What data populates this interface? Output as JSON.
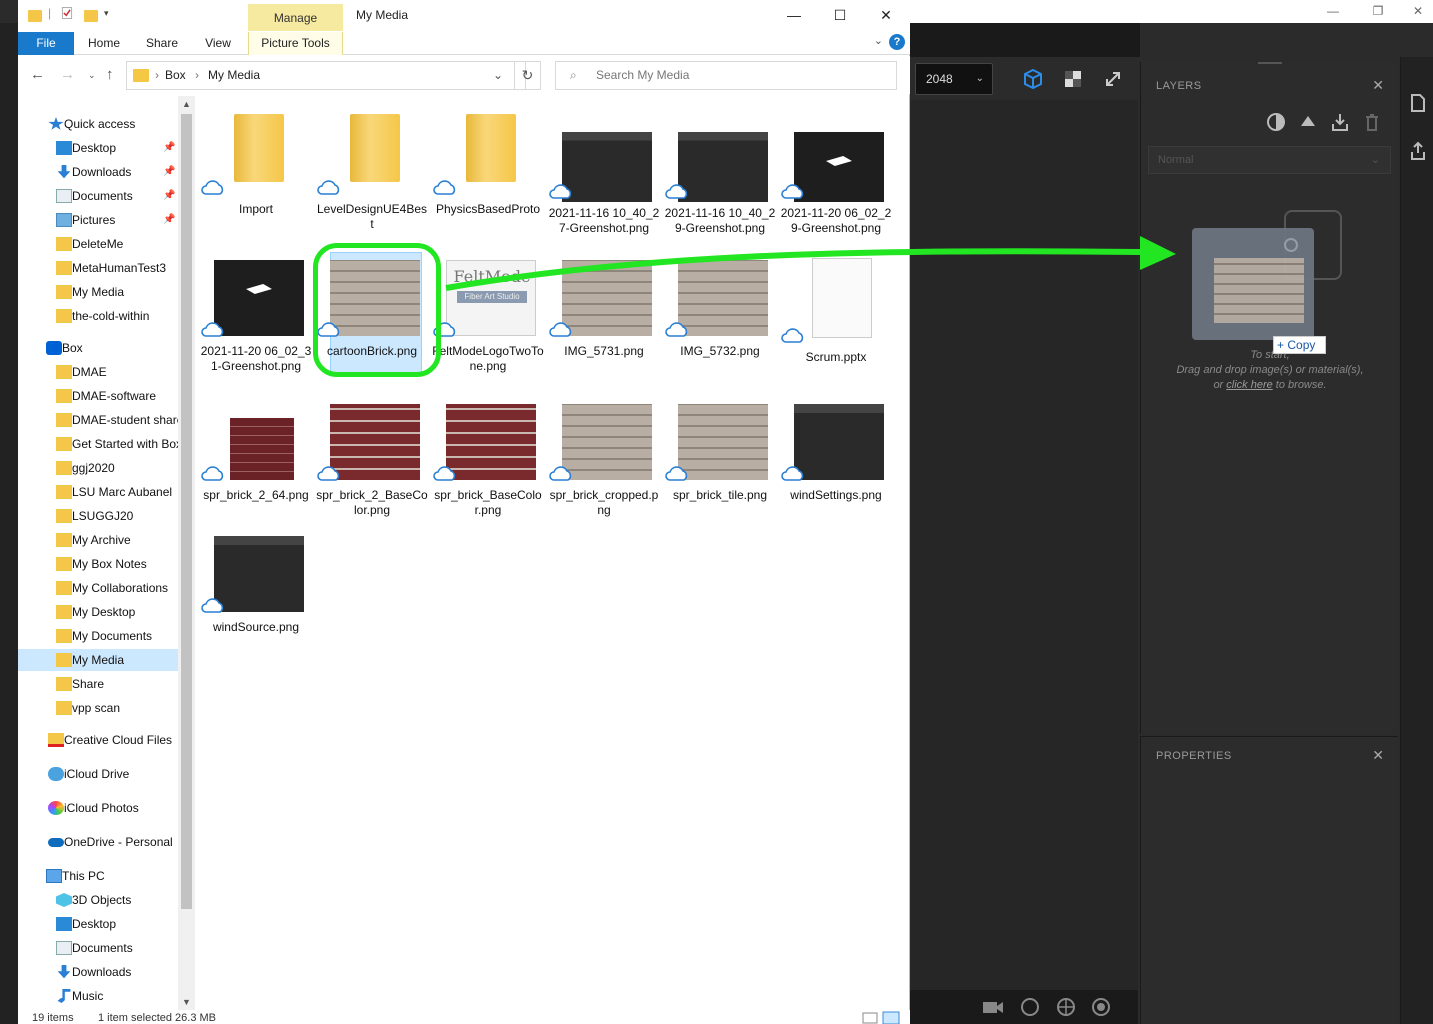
{
  "explorer": {
    "window_title": "My Media",
    "ribbon_context": "Manage",
    "tabs": [
      "File",
      "Home",
      "Share",
      "View",
      "Picture Tools"
    ],
    "address": {
      "segments": [
        "Box",
        "My Media"
      ]
    },
    "search_placeholder": "Search My Media",
    "nav": {
      "quick_access": {
        "label": "Quick access",
        "items": [
          "Desktop",
          "Downloads",
          "Documents",
          "Pictures",
          "DeleteMe",
          "MetaHumanTest3",
          "My Media",
          "the-cold-within"
        ]
      },
      "box": {
        "label": "Box",
        "items": [
          "DMAE",
          "DMAE-software",
          "DMAE-student share",
          "Get Started with Box",
          "ggj2020",
          "LSU Marc Aubanel",
          "LSUGGJ20",
          "My Archive",
          "My Box Notes",
          "My Collaborations",
          "My Desktop",
          "My Documents",
          "My Media",
          "Share",
          "vpp scan"
        ]
      },
      "creative_cloud": "Creative Cloud Files",
      "icloud_drive": "iCloud Drive",
      "icloud_photos": "iCloud Photos",
      "onedrive": "OneDrive - Personal",
      "this_pc": {
        "label": "This PC",
        "items": [
          "3D Objects",
          "Desktop",
          "Documents",
          "Downloads",
          "Music"
        ]
      }
    },
    "files": [
      {
        "name": "Import",
        "kind": "folder"
      },
      {
        "name": "LevelDesignUE4Best",
        "kind": "folder"
      },
      {
        "name": "PhysicsBasedProto",
        "kind": "folder"
      },
      {
        "name": "2021-11-16 10_40_27-Greenshot.png",
        "kind": "screenshot"
      },
      {
        "name": "2021-11-16 10_40_29-Greenshot.png",
        "kind": "screenshot"
      },
      {
        "name": "2021-11-20 06_02_29-Greenshot.png",
        "kind": "dark"
      },
      {
        "name": "2021-11-20 06_02_31-Greenshot.png",
        "kind": "dark"
      },
      {
        "name": "cartoonBrick.png",
        "kind": "brick-tan"
      },
      {
        "name": "FeltModeLogoTwoTone.png",
        "kind": "logo"
      },
      {
        "name": "IMG_5731.png",
        "kind": "brick-tan"
      },
      {
        "name": "IMG_5732.png",
        "kind": "brick-tan"
      },
      {
        "name": "Scrum.pptx",
        "kind": "doc"
      },
      {
        "name": "spr_brick_2_64.png",
        "kind": "brick-red-small"
      },
      {
        "name": "spr_brick_2_BaseColor.png",
        "kind": "brick-red"
      },
      {
        "name": "spr_brick_BaseColor.png",
        "kind": "brick-red"
      },
      {
        "name": "spr_brick_cropped.png",
        "kind": "brick-tan"
      },
      {
        "name": "spr_brick_tile.png",
        "kind": "brick-tan"
      },
      {
        "name": "windSettings.png",
        "kind": "screenshot"
      },
      {
        "name": "windSource.png",
        "kind": "screenshot"
      }
    ],
    "logo_text": "FeltMode",
    "logo_subtext": "Fiber Art Studio",
    "status": {
      "count": "19 items",
      "selection": "1 item selected  26.3 MB"
    }
  },
  "editor": {
    "resolution": "2048",
    "layers_title": "LAYERS",
    "blend_mode": "Normal",
    "drop_hint": [
      "To start,",
      "Drag and drop image(s) or material(s),"
    ],
    "drop_hint_or": "or ",
    "drop_hint_link": "click here",
    "drop_hint_tail": " to browse.",
    "copy_badge": "Copy",
    "properties_title": "PROPERTIES"
  },
  "colors": {
    "annotation_green": "#22e622",
    "file_tab_blue": "#1979ca",
    "selection_blue": "#cce8ff"
  }
}
